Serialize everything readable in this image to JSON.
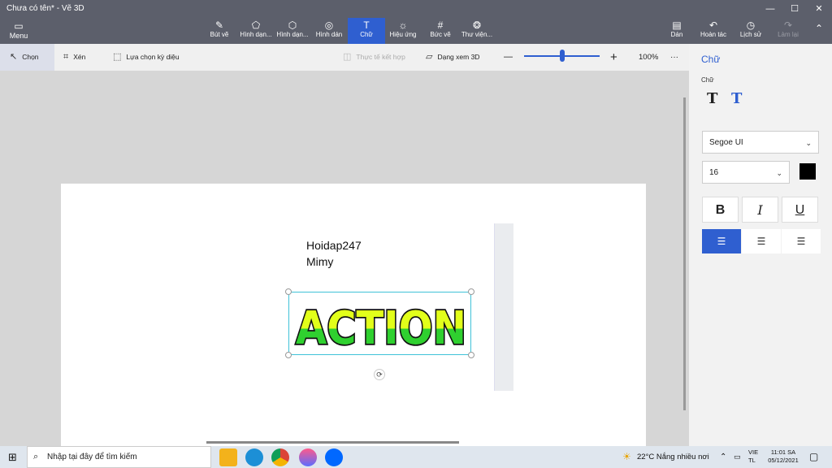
{
  "window": {
    "title": "Chưa có tên* - Vẽ 3D",
    "controls": {
      "minimize": "—",
      "maximize": "☐",
      "close": "✕"
    }
  },
  "toolbar": {
    "menu": "Menu",
    "tools": [
      {
        "label": "Bút vẽ",
        "icon": "brush-icon"
      },
      {
        "label": "Hình dạn...",
        "icon": "2d-shapes-icon"
      },
      {
        "label": "Hình dạn...",
        "icon": "3d-shapes-icon"
      },
      {
        "label": "Hình dán",
        "icon": "sticker-icon"
      },
      {
        "label": "Chữ",
        "icon": "text-icon"
      },
      {
        "label": "Hiệu ứng",
        "icon": "effects-icon"
      },
      {
        "label": "Bức vẽ",
        "icon": "canvas-icon"
      },
      {
        "label": "Thư viện...",
        "icon": "3d-library-icon"
      }
    ],
    "right": [
      {
        "label": "Dán",
        "icon": "paste-icon"
      },
      {
        "label": "Hoàn tác",
        "icon": "undo-icon"
      },
      {
        "label": "Lịch sử",
        "icon": "history-icon"
      },
      {
        "label": "Làm lại",
        "icon": "redo-icon"
      }
    ]
  },
  "subtoolbar": {
    "select": "Chọn",
    "crop": "Xén",
    "magic_select": "Lựa chọn kỳ diệu",
    "mixed_reality": "Thực tế kết hợp",
    "view_3d": "Dạng xem 3D",
    "zoom_minus": "—",
    "zoom_plus": "+",
    "zoom": "100%",
    "more": "···",
    "zoom_fraction": 0.5
  },
  "canvas": {
    "lines": [
      "Hoidap247",
      "Mimy"
    ],
    "sticker_text": "ACTION",
    "colors": {
      "sticker_top": "#e2ff1a",
      "sticker_bottom": "#2fd02f",
      "outline": "#111111",
      "selection": "#3fc2d8"
    }
  },
  "panel": {
    "title": "Chữ",
    "section": "Chữ",
    "font": "Segoe UI",
    "size": "16",
    "color": "#000000",
    "bold": "B",
    "italic": "I",
    "underline": "U",
    "alignments": [
      "align-left-icon",
      "align-center-icon",
      "align-right-icon"
    ]
  },
  "taskbar": {
    "search_placeholder": "Nhập tại đây để tìm kiếm",
    "weather": "22°C  Nắng nhiều nơi",
    "lang_top": "VIE",
    "lang_bottom": "TL",
    "time": "11:01 SA",
    "date": "05/12/2021"
  }
}
